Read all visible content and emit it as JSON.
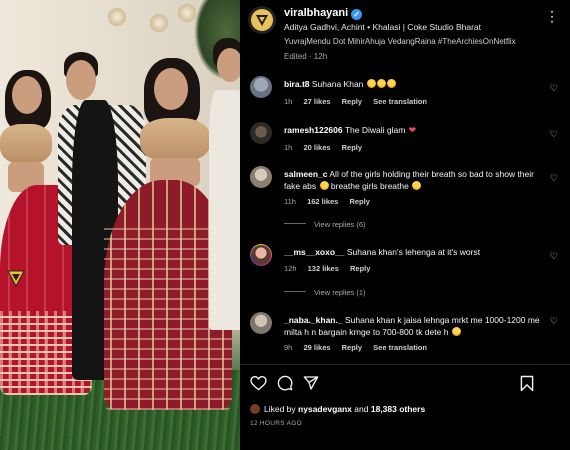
{
  "post": {
    "username": "viralbhayani",
    "subtitle": "Aditya Gadhvi, Achint • Khalasi | Coke Studio Bharat",
    "caption_tail": "YuvrajMendu Dot MihirAhuja VedangRaina #TheArchiesOnNetflix",
    "edited": "Edited · 12h"
  },
  "comments": [
    {
      "user": "bira.t8",
      "text": "Suhana Khan",
      "emojis": [
        "love",
        "love",
        "love"
      ],
      "time": "1h",
      "likes": "27 likes",
      "reply": "Reply",
      "translation": "See translation"
    },
    {
      "user": "ramesh122606",
      "text": "The Diwali glam",
      "emojis": [
        "heart"
      ],
      "time": "1h",
      "likes": "20 likes",
      "reply": "Reply",
      "translation": ""
    },
    {
      "user": "salmeen_c",
      "text": "All of the girls holding their breath so bad to show their fake abs",
      "text2": "breathe girls breathe",
      "time": "11h",
      "likes": "162 likes",
      "reply": "Reply",
      "translation": "",
      "view_replies": "View replies (6)"
    },
    {
      "user": "__ms__xoxo__",
      "text": "Suhana khan's lehenga at it's worst",
      "time": "12h",
      "likes": "132 likes",
      "reply": "Reply",
      "translation": "",
      "view_replies": "View replies (1)"
    },
    {
      "user": "_naba._khan._",
      "text": "Suhana khan k jaisa lehnga mrkt me 1000-1200 me milta h n bargain krnge to 700-800 tk dete h",
      "time": "9h",
      "likes": "29 likes",
      "reply": "Reply",
      "translation": "See translation"
    }
  ],
  "footer": {
    "liked_by_prefix": "Liked by",
    "liked_by_user": "nysadevganx",
    "liked_by_and": "and",
    "liked_by_count": "18,383 others",
    "time_ago": "12 HOURS AGO"
  },
  "icons": {
    "header_more": "more-horizontal-icon",
    "verified": "verified-badge-icon",
    "like": "heart-icon",
    "comment": "comment-icon",
    "share": "share-icon",
    "save": "bookmark-icon"
  },
  "colors": {
    "background": "#000000",
    "verified_blue": "#3897f0",
    "muted_text": "#a8a8a8"
  }
}
